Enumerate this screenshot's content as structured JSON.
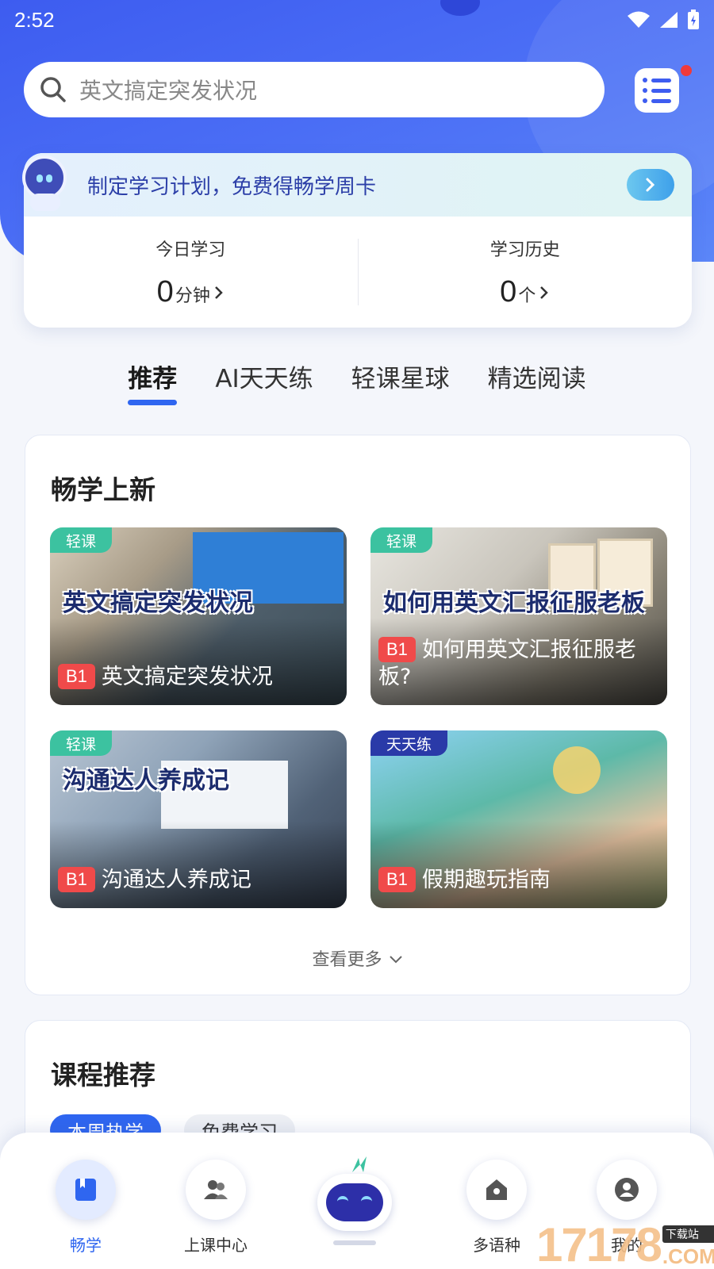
{
  "status_bar": {
    "time": "2:52"
  },
  "search": {
    "placeholder": "英文搞定突发状况"
  },
  "plan_banner": {
    "text": "制定学习计划，免费得畅学周卡"
  },
  "stats": [
    {
      "label": "今日学习",
      "value": "0",
      "unit": "分钟"
    },
    {
      "label": "学习历史",
      "value": "0",
      "unit": "个"
    }
  ],
  "tabs": [
    "推荐",
    "AI天天练",
    "轻课星球",
    "精选阅读"
  ],
  "new_section": {
    "title": "畅学上新",
    "cards": [
      {
        "tag": "轻课",
        "overlay_title": "英文搞定突发状况",
        "level": "B1",
        "caption": "英文搞定突发状况"
      },
      {
        "tag": "轻课",
        "overlay_title": "如何用英文汇报征服老板",
        "level": "B1",
        "caption": "如何用英文汇报征服老板?"
      },
      {
        "tag": "轻课",
        "overlay_title": "沟通达人养成记",
        "level": "B1",
        "caption": "沟通达人养成记"
      },
      {
        "tag": "天天练",
        "overlay_title": "",
        "level": "B1",
        "caption": "假期趣玩指南"
      }
    ],
    "see_more": "查看更多"
  },
  "course_section": {
    "title": "课程推荐",
    "chips": [
      "本周热学",
      "免费学习"
    ]
  },
  "bottom_nav": [
    {
      "label": "畅学",
      "icon": "book-icon"
    },
    {
      "label": "上课中心",
      "icon": "users-icon"
    },
    {
      "label": "",
      "icon": "robot-icon"
    },
    {
      "label": "多语种",
      "icon": "home-icon"
    },
    {
      "label": "我的",
      "icon": "user-icon"
    }
  ],
  "watermark": {
    "number": "17178",
    "badge": "下载站",
    "domain": ".COM"
  },
  "colors": {
    "accent": "#2f66f0",
    "hero": "#3d5cf0",
    "level_badge": "#f04a4a",
    "tag_green": "#3cc2a0"
  }
}
